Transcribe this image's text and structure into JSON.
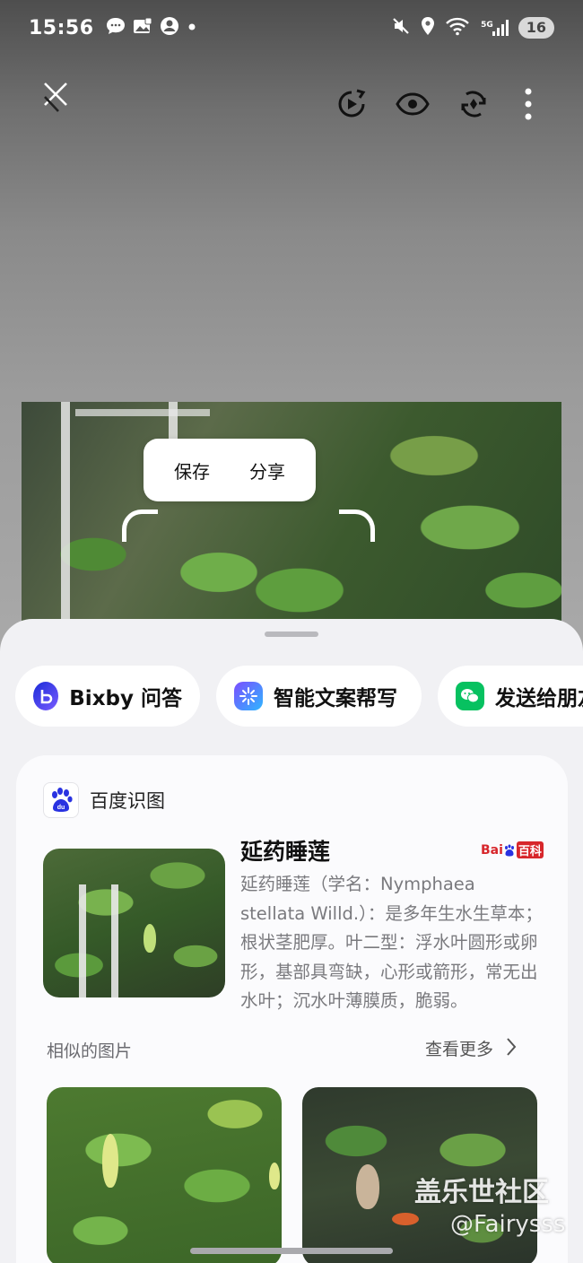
{
  "status_bar": {
    "time": "15:56",
    "network": "5G",
    "battery": "16",
    "icons": [
      "message-icon",
      "gallery-icon",
      "account-icon",
      "dot-icon",
      "mute-icon",
      "location-icon",
      "wifi-icon",
      "signal-icon"
    ]
  },
  "toolbar": {
    "icons": [
      "close-icon",
      "motion-play-icon",
      "eye-icon",
      "remaster-icon",
      "more-options-icon"
    ]
  },
  "popup_menu": {
    "save_label": "保存",
    "share_label": "分享"
  },
  "chips": [
    {
      "label": "Bixby 问答",
      "icon": "bixby-icon",
      "color": "#3b5bff"
    },
    {
      "label": "智能文案帮写",
      "icon": "writing-assist-icon",
      "color": "#3aa0ff"
    },
    {
      "label": "发送给朋友",
      "icon": "wechat-icon",
      "color": "#07c160"
    }
  ],
  "result": {
    "source": "百度识图",
    "title": "延药睡莲",
    "badge_bai": "Bai",
    "badge_baike": "百科",
    "description": "延药睡莲（学名：Nymphaea stellata Willd.）：是多年生水生草本；根状茎肥厚。叶二型：浮水叶圆形或卵形，基部具弯缺，心形或箭形，常无出水叶；沉水叶薄膜质，脆弱。",
    "similar_label": "相似的图片",
    "more_label": "查看更多"
  },
  "watermark": {
    "site": "盖乐世社区",
    "user": "@Fairysss"
  },
  "colors": {
    "sheet_bg": "#f1f1f4",
    "card_bg": "#fbfbfd",
    "baidu_blue": "#2932e1",
    "baike_red": "#d7262b"
  }
}
